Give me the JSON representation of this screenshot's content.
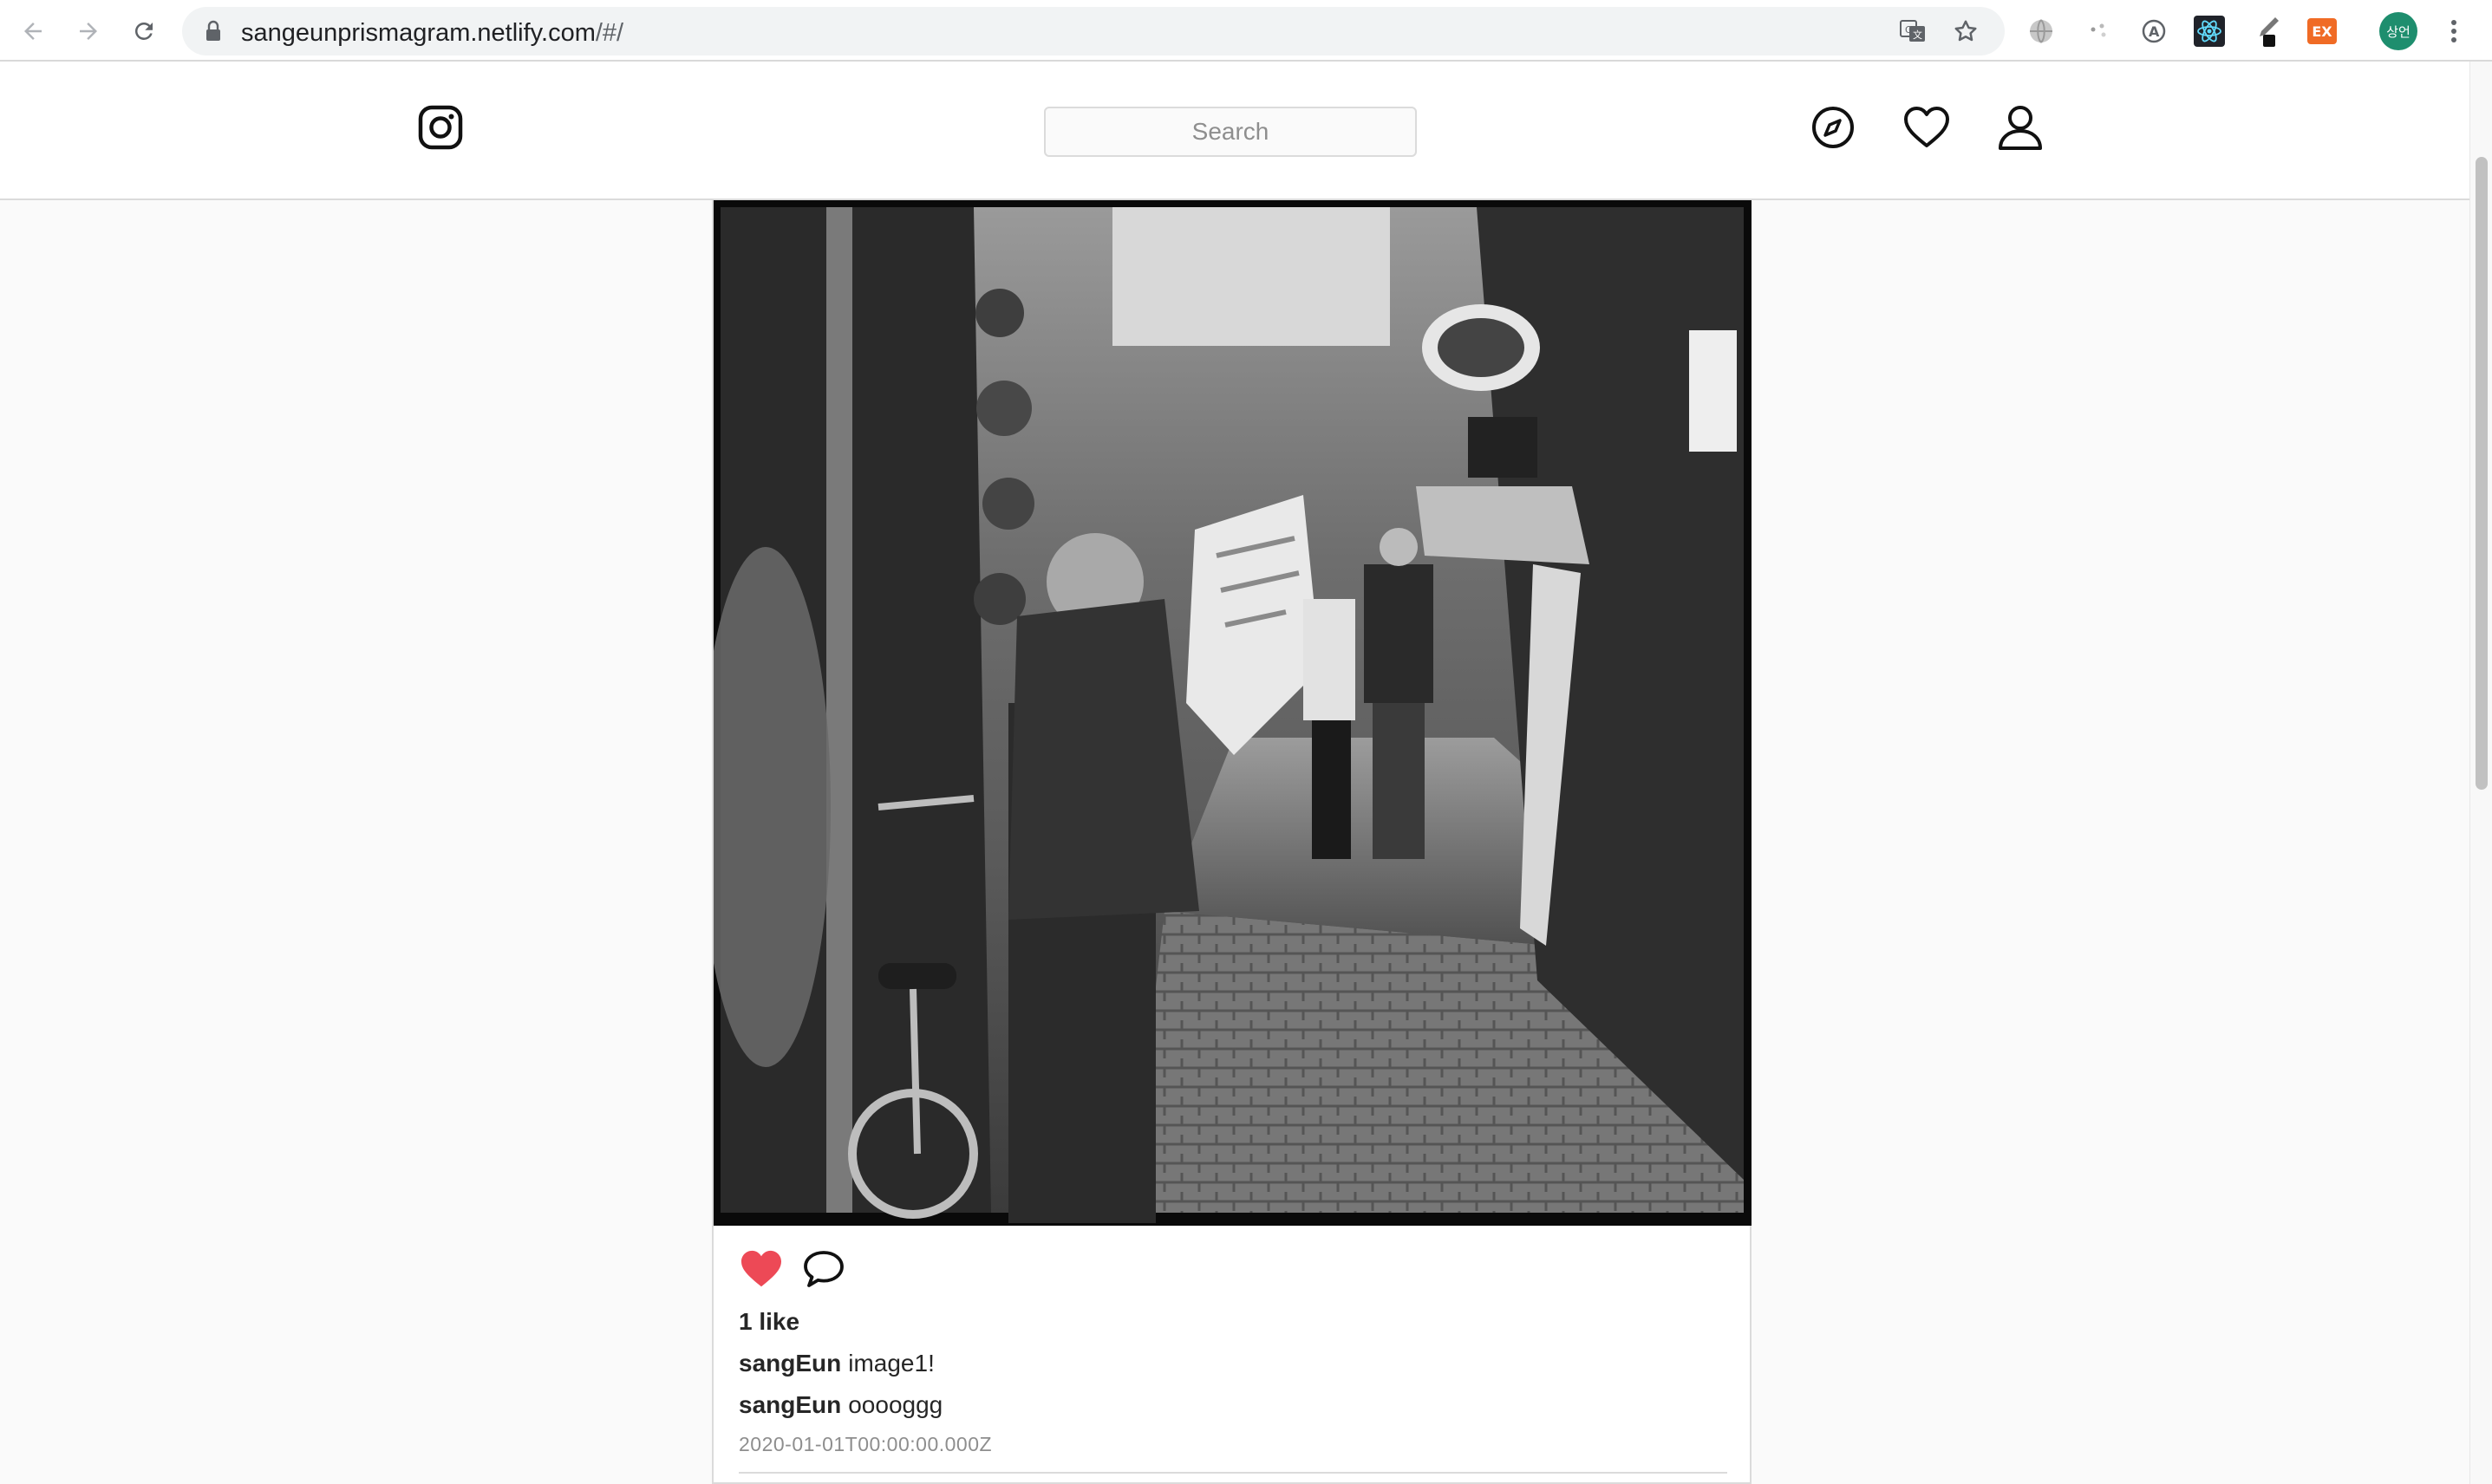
{
  "browser": {
    "url_host": "sangeunprismagram.netlify.com",
    "url_path": "/#/",
    "profile_initials": "상언",
    "extension_badge": "EX",
    "colors": {
      "profile_bg": "#1e8e6e",
      "extension_bg": "#f06b25",
      "react_bg": "#20232a",
      "react_fg": "#61dafb"
    }
  },
  "header": {
    "logo_icon": "instagram-icon",
    "search_placeholder": "Search",
    "icons": [
      "compass-icon",
      "heart-icon",
      "user-icon"
    ]
  },
  "post": {
    "photo_description_icon": "photo",
    "liked": true,
    "like_color": "#ed4956",
    "likes_text": "1 like",
    "caption": {
      "user": "sangEun",
      "text": "image1!"
    },
    "comments": [
      {
        "user": "sangEun",
        "text": "ooooggg"
      }
    ],
    "timestamp": "2020-01-01T00:00:00.000Z"
  }
}
